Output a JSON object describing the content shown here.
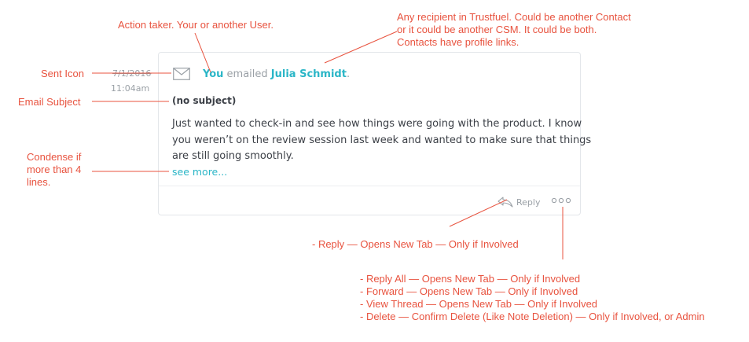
{
  "annotations": {
    "action_taker": "Action taker. Your or another User.",
    "recipient": [
      "Any recipient in Trustfuel. Could be another Contact",
      "or it could be another CSM. It could be both.",
      "Contacts have profile links."
    ],
    "sent_icon": "Sent Icon",
    "email_subject": "Email Subject",
    "condense": [
      "Condense if",
      "more than 4",
      "lines."
    ],
    "reply": "- Reply — Opens New Tab — Only if Involved",
    "more_menu": [
      "- Reply All — Opens New Tab — Only if Involved",
      "- Forward — Opens New Tab — Only if Involved",
      "- View Thread — Opens New Tab — Only if Involved",
      "- Delete — Confirm Delete (Like Note Deletion) — Only if Involved, or Admin"
    ]
  },
  "card": {
    "date": "7/1/2016",
    "time": "11:04am",
    "actor": "You",
    "verb": "emailed",
    "recipient": "Julia Schmidt",
    "punct": ".",
    "subject": "(no subject)",
    "body_lines": [
      "Just wanted to check-in and see how things were going with the product. I know",
      "you weren’t on the review session last week and wanted to make sure that things",
      "are still going smoothly."
    ],
    "see_more": "see more...",
    "reply_label": "Reply"
  },
  "colors": {
    "annotation": "#e8533f",
    "accent": "#2bb6c7",
    "muted": "#9aa0a6",
    "text": "#3c4047"
  },
  "icons": {
    "sent": "envelope-icon",
    "reply": "reply-arrow-icon",
    "more": "more-dots-icon"
  }
}
